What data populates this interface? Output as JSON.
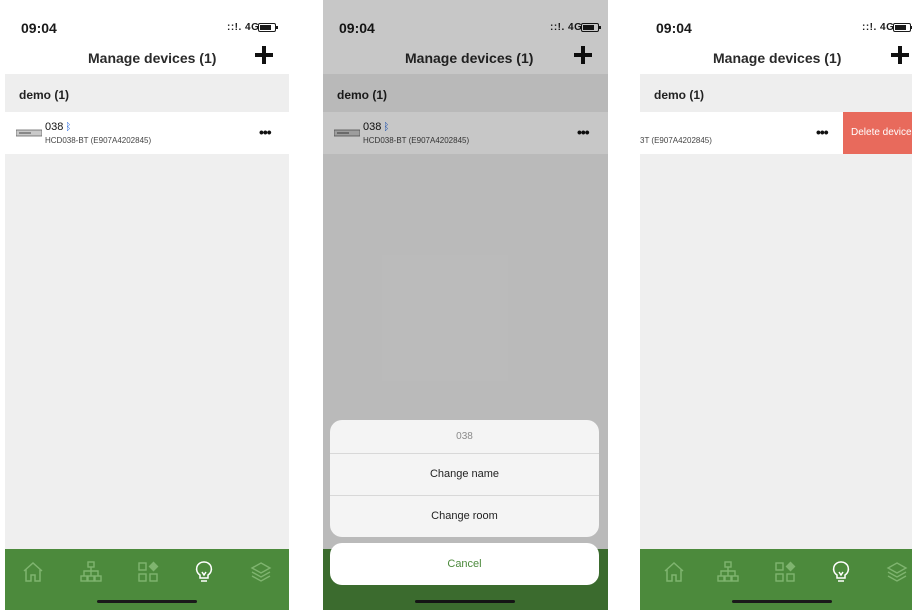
{
  "status": {
    "time": "09:04",
    "signal": "::!. 4G"
  },
  "nav": {
    "title": "Manage devices (1)"
  },
  "group": {
    "label": "demo (1)"
  },
  "device": {
    "name": "038",
    "id": "HCD038-BT (E907A4202845)",
    "id_partial": "3T (E907A4202845)",
    "more": "•••"
  },
  "action_sheet": {
    "title": "038",
    "options": [
      "Change name",
      "Change room"
    ],
    "cancel": "Cancel"
  },
  "swipe": {
    "delete_label": "Delete device"
  },
  "colors": {
    "tab_bar": "#4c8a3c",
    "delete": "#e86a5c",
    "bluetooth": "#2e6ee0"
  },
  "tabs": [
    "home-icon",
    "network-icon",
    "scenes-icon",
    "lightbulb-icon",
    "layers-icon"
  ],
  "active_tab": "lightbulb-icon"
}
